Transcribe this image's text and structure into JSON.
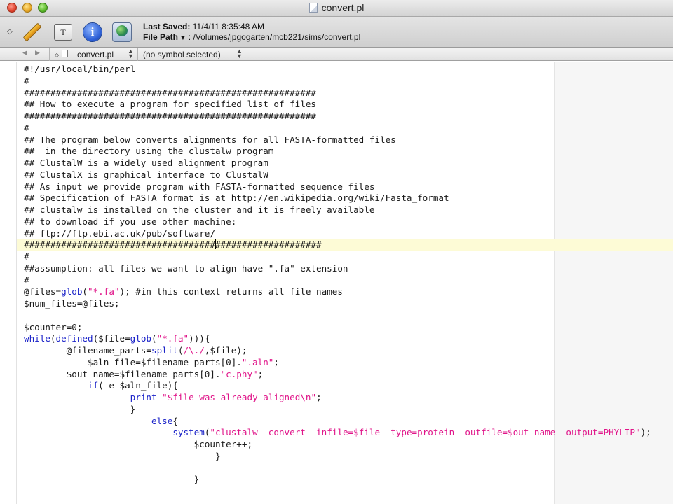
{
  "window": {
    "title": "convert.pl"
  },
  "toolbar": {
    "last_saved_label": "Last Saved:",
    "last_saved_value": "11/4/11 8:35:48 AM",
    "file_path_label": "File Path",
    "file_path_value": ": /Volumes/jpgogarten/mcb221/sims/convert.pl",
    "text_button_glyph": "T",
    "info_button_glyph": "i"
  },
  "navbar": {
    "file_name": "convert.pl",
    "symbol": "(no symbol selected)"
  },
  "icons": {
    "close": "close-icon",
    "minimize": "minimize-icon",
    "zoom": "zoom-icon",
    "pencil": "pencil-icon",
    "text": "text-icon",
    "info": "info-icon",
    "globe": "globe-icon"
  },
  "colors": {
    "keyword": "#1b23c8",
    "string": "#e01489",
    "current_line": "#fdfbd6"
  },
  "code_lines": [
    "#!/usr/local/bin/perl",
    "#",
    "#######################################################",
    "## How to execute a program for specified list of files",
    "#######################################################",
    "#",
    "## The program below converts alignments for all FASTA-formatted files",
    "##  in the directory using the clustalw program",
    "## ClustalW is a widely used alignment program",
    "## ClustalX is graphical interface to ClustalW",
    "## As input we provide program with FASTA-formatted sequence files",
    "## Specification of FASTA format is at http://en.wikipedia.org/wiki/Fasta_format",
    "## clustalw is installed on the cluster and it is freely available",
    "## to download if you use other machine:",
    "## ftp://ftp.ebi.ac.uk/pub/software/",
    "########################################################",
    "#",
    "##assumption: all files we want to align have \".fa\" extension",
    "#",
    "@files=glob(\"*.fa\"); #in this context returns all file names",
    "$num_files=@files;",
    "",
    "$counter=0;",
    "while(defined($file=glob(\"*.fa\"))){",
    "        @filename_parts=split(/\\./,$file);",
    "            $aln_file=$filename_parts[0].\".aln\";",
    "        $out_name=$filename_parts[0].\"c.phy\";",
    "            if(-e $aln_file){",
    "                    print \"$file was already aligned\\n\";",
    "                    }",
    "                        else{",
    "                            system(\"clustalw -convert -infile=$file -type=protein -outfile=$out_name -output=PHYLIP\");",
    "                                $counter++;",
    "                                    }",
    "",
    "                                }"
  ]
}
